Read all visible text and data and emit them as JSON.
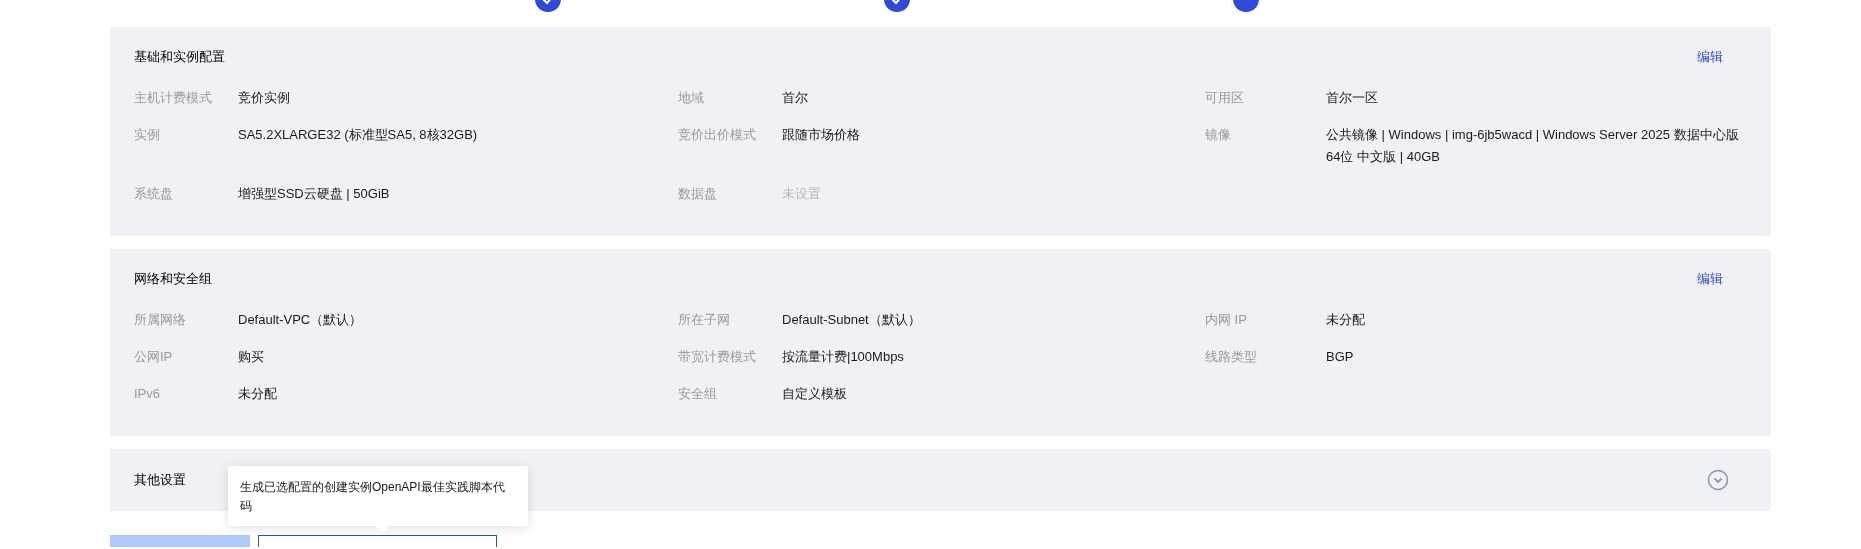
{
  "steps": [
    {
      "completed": true
    },
    {
      "completed": true
    },
    {
      "completed": false
    }
  ],
  "sections": [
    {
      "title": "基础和实例配置",
      "action": "编辑",
      "fields": [
        {
          "label": "主机计费模式",
          "value": "竞价实例",
          "unset": false
        },
        {
          "label": "地域",
          "value": "首尔",
          "unset": false
        },
        {
          "label": "可用区",
          "value": "首尔一区",
          "unset": false
        },
        {
          "label": "实例",
          "value": "SA5.2XLARGE32 (标准型SA5, 8核32GB)",
          "unset": false
        },
        {
          "label": "竞价出价模式",
          "value": "跟随市场价格",
          "unset": false
        },
        {
          "label": "镜像",
          "value": "公共镜像 | Windows | img-6jb5wacd | Windows Server 2025 数据中心版 64位 中文版 | 40GB",
          "unset": false
        },
        {
          "label": "系统盘",
          "value": "增强型SSD云硬盘 | 50GiB",
          "unset": false
        },
        {
          "label": "数据盘",
          "value": "未设置",
          "unset": true
        }
      ]
    },
    {
      "title": "网络和安全组",
      "action": "编辑",
      "fields": [
        {
          "label": "所属网络",
          "value": "Default-VPC（默认）",
          "unset": false
        },
        {
          "label": "所在子网",
          "value": "Default-Subnet（默认）",
          "unset": false
        },
        {
          "label": "内网 IP",
          "value": "未分配",
          "unset": false
        },
        {
          "label": "公网IP",
          "value": "购买",
          "unset": false
        },
        {
          "label": "带宽计费模式",
          "value": "按流量计费|100Mbps",
          "unset": false
        },
        {
          "label": "线路类型",
          "value": "BGP",
          "unset": false
        },
        {
          "label": "IPv6",
          "value": "未分配",
          "unset": false
        },
        {
          "label": "安全组",
          "value": "自定义模板",
          "unset": false
        }
      ]
    }
  ],
  "other_settings": {
    "title": "其他设置",
    "expanded": false
  },
  "tooltip": {
    "text": "生成已选配置的创建实例OpenAPI最佳实践脚本代码"
  },
  "buttons": [
    {
      "kind": "primary"
    },
    {
      "kind": "outline"
    }
  ]
}
